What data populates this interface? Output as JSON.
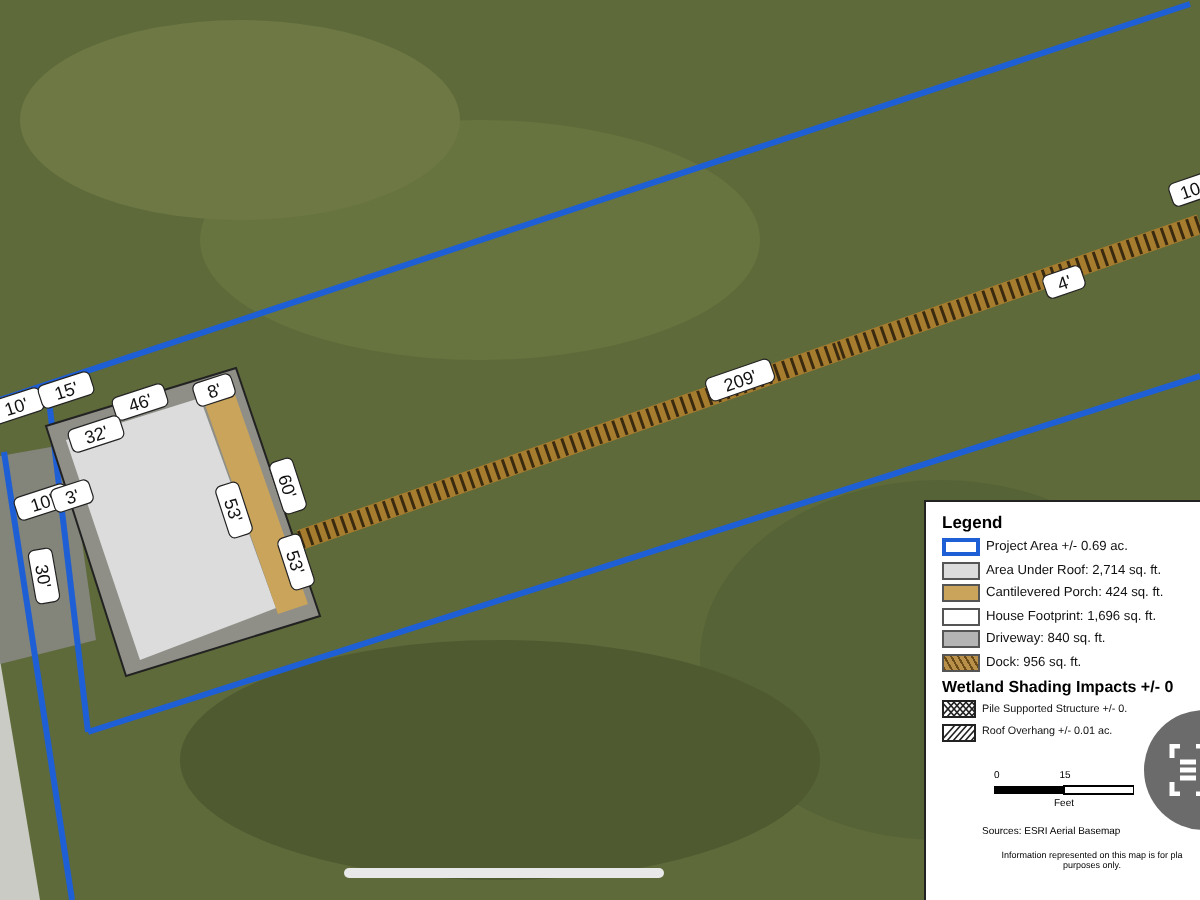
{
  "map": {
    "dimension_labels": [
      "10'",
      "15'",
      "46'",
      "32'",
      "8'",
      "10'",
      "3'",
      "30'",
      "53'",
      "60'",
      "53'",
      "209'",
      "4'",
      "10"
    ]
  },
  "legend": {
    "title": "Legend",
    "items": [
      {
        "kind": "outline",
        "color": "#1f5fd6",
        "label": "Project Area +/- 0.69 ac."
      },
      {
        "kind": "fill",
        "color": "#dcdcdc",
        "label": "Area Under Roof: 2,714 sq. ft."
      },
      {
        "kind": "fill",
        "color": "#c9a45a",
        "label": "Cantilevered Porch: 424 sq. ft."
      },
      {
        "kind": "fill",
        "color": "#ffffff",
        "label": "House Footprint: 1,696 sq. ft."
      },
      {
        "kind": "fill",
        "color": "#b4b4b4",
        "label": "Driveway: 840 sq. ft."
      },
      {
        "kind": "hatch",
        "color": "#b8904a",
        "label": "Dock: 956 sq. ft."
      }
    ],
    "impacts_title": "Wetland Shading Impacts +/- 0",
    "impacts": [
      {
        "kind": "crosshatch",
        "label": "Pile Supported Structure +/- 0."
      },
      {
        "kind": "diagonal",
        "label": "Roof Overhang +/- 0.01 ac."
      }
    ],
    "scale": {
      "ticks": [
        "0",
        "15"
      ],
      "unit": "Feet"
    },
    "sources": "Sources: ESRI Aerial Basemap",
    "note": [
      "Information represented on this map is for pla",
      "purposes only."
    ]
  }
}
